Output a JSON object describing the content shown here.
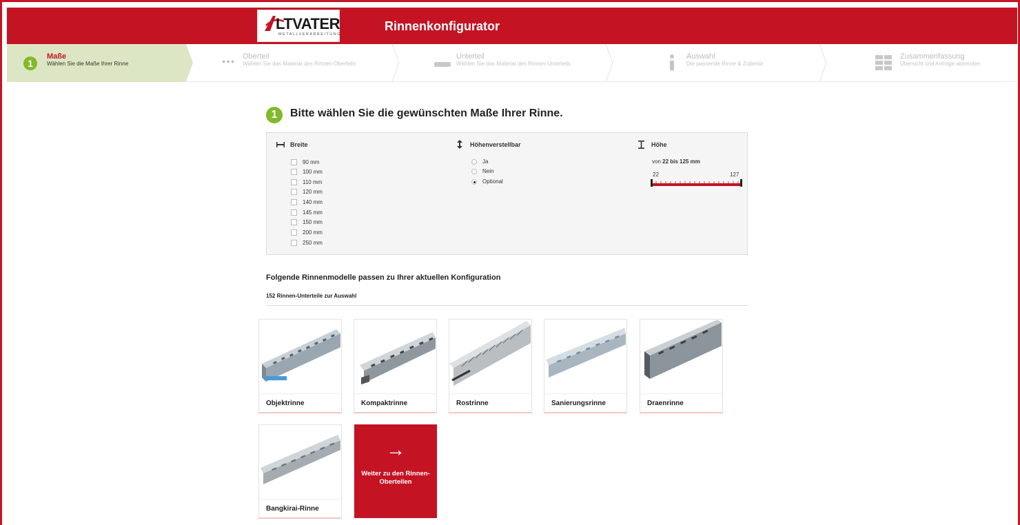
{
  "header": {
    "logo_text": "LTVATER",
    "logo_sub": "METALLVERARBEITUNG",
    "title": "Rinnenkonfigurator",
    "brand_color": "#c41424"
  },
  "steps": [
    {
      "number": "1",
      "title": "Maße",
      "desc": "Wählen Sie die Maße Ihrer Rinne",
      "state": "active"
    },
    {
      "title": "Oberteil",
      "desc": "Wählen Sie das Material des Rinnen-Oberteils",
      "icon": "dots-icon",
      "state": "inactive"
    },
    {
      "title": "Unterteil",
      "desc": "Wählen Sie das Material des Rinnen-Unterteils",
      "icon": "bar-icon",
      "state": "inactive"
    },
    {
      "title": "Auswahl",
      "desc": "Die passende Rinne & Zubehör",
      "icon": "info-icon",
      "state": "inactive"
    },
    {
      "title": "Zusammenfassung",
      "desc": "Übersicht und Anfrage absenden",
      "icon": "grid-icon",
      "state": "inactive"
    }
  ],
  "main": {
    "number": "1",
    "heading": "Bitte wählen Sie die gewünschten Maße Ihrer Rinne."
  },
  "filters": {
    "breite": {
      "label": "Breite",
      "icon": "width-icon",
      "options": [
        "90 mm",
        "100 mm",
        "110 mm",
        "120 mm",
        "140 mm",
        "145 mm",
        "150 mm",
        "200 mm",
        "250 mm"
      ]
    },
    "hoehenverstellbar": {
      "label": "Höhenverstellbar",
      "icon": "vertical-arrows-icon",
      "options": [
        "Ja",
        "Nein",
        "Optional"
      ],
      "selected": "Optional"
    },
    "hoehe": {
      "label": "Höhe",
      "icon": "height-icon",
      "range_prefix": "von ",
      "range_value": "22 bis 125 mm",
      "slider_min": "22",
      "slider_max": "127"
    }
  },
  "results": {
    "title": "Folgende Rinnenmodelle passen zu Ihrer aktuellen Konfiguration",
    "count": "152 Rinnen-Unterteile zur Auswahl",
    "products": [
      "Objektrinne",
      "Kompaktrinne",
      "Rostrinne",
      "Sanierungsrinne",
      "Draenrinne",
      "Bangkirai-Rinne"
    ],
    "next_button": {
      "arrow": "→",
      "label": "Weiter zu den Rinnen-Oberteilen"
    }
  }
}
